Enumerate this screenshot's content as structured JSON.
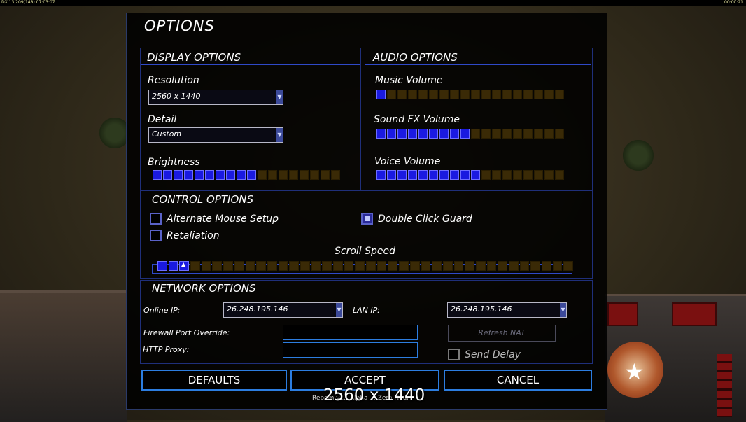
{
  "hud": {
    "left": "DX 13 209(148) 07:03:07",
    "right": "00:00:21"
  },
  "dialog": {
    "title": "OPTIONS"
  },
  "display": {
    "heading": "DISPLAY OPTIONS",
    "resolution_label": "Resolution",
    "resolution_value": "2560 x 1440",
    "detail_label": "Detail",
    "detail_value": "Custom",
    "brightness_label": "Brightness",
    "brightness_level": 10,
    "brightness_total": 18
  },
  "audio": {
    "heading": "AUDIO OPTIONS",
    "music_label": "Music Volume",
    "music_level": 1,
    "sfx_label": "Sound FX Volume",
    "sfx_level": 9,
    "voice_label": "Voice Volume",
    "voice_level": 10,
    "total": 18
  },
  "control": {
    "heading": "CONTROL OPTIONS",
    "alt_mouse_label": "Alternate Mouse Setup",
    "alt_mouse_checked": false,
    "retaliation_label": "Retaliation",
    "retaliation_checked": false,
    "double_click_label": "Double Click Guard",
    "double_click_checked": true,
    "scroll_label": "Scroll Speed",
    "scroll_level": 3,
    "scroll_total": 38
  },
  "network": {
    "heading": "NETWORK OPTIONS",
    "online_ip_label": "Online IP:",
    "online_ip_value": "26.248.195.146",
    "lan_ip_label": "LAN IP:",
    "lan_ip_value": "26.248.195.146",
    "firewall_label": "Firewall Port Override:",
    "http_proxy_label": "HTTP Proxy:",
    "refresh_nat_label": "Refresh NAT",
    "send_delay_label": "Send Delay",
    "send_delay_checked": false
  },
  "buttons": {
    "defaults": "DEFAULTS",
    "accept": "ACCEPT",
    "cancel": "CANCEL"
  },
  "footer": {
    "text": "Rebom v ... Alpha ... Zero Hour"
  },
  "overlay": {
    "resolution_text": "2560 x 1440"
  },
  "colors": {
    "accent_blue": "#2f49c8",
    "slider_on": "#1a1ae0",
    "slider_off": "#3a2a06"
  }
}
